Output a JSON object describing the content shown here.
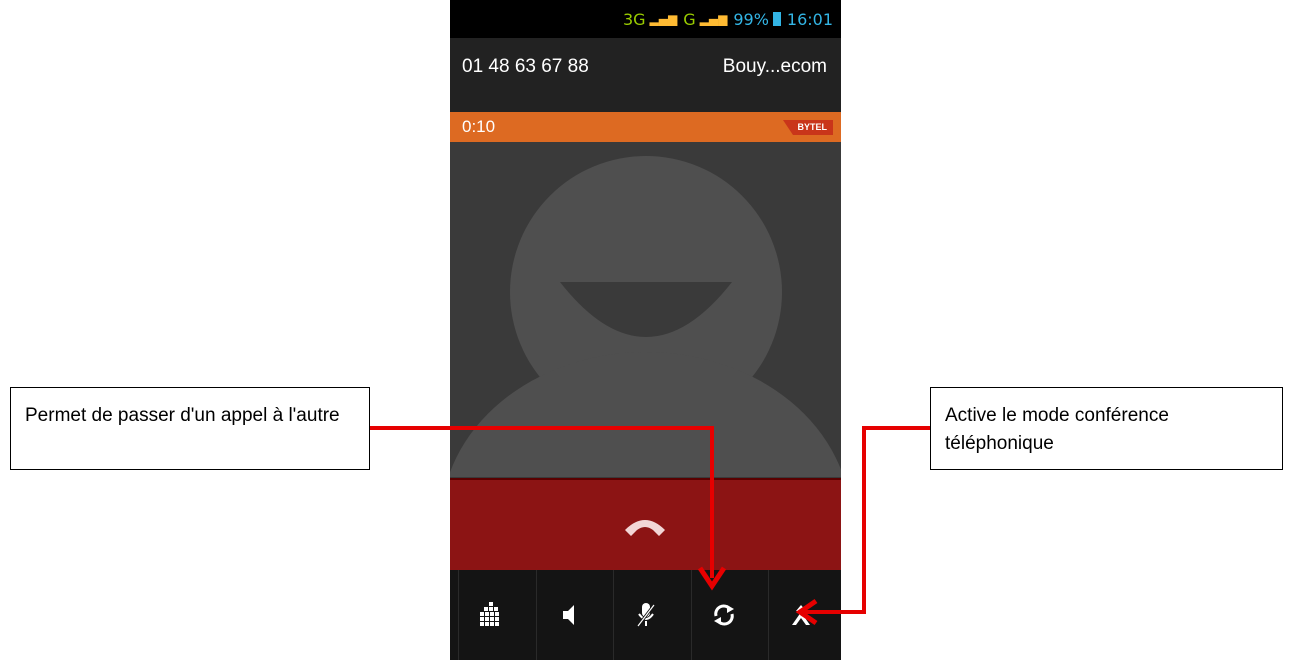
{
  "status_bar": {
    "network": "3G",
    "network2": "G",
    "battery": "99%",
    "time": "16:01"
  },
  "call": {
    "number": "01 48 63 67 88",
    "operator": "Bouy...ecom",
    "duration": "0:10",
    "badge": "BYTEL"
  },
  "controls": [
    {
      "name": "dialpad-icon"
    },
    {
      "name": "speaker-icon"
    },
    {
      "name": "mute-icon"
    },
    {
      "name": "swap-call-icon"
    },
    {
      "name": "merge-call-icon"
    }
  ],
  "callouts": {
    "left": "Permet de passer d'un appel à l'autre",
    "right": "Active le mode conférence téléphonique"
  },
  "colors": {
    "accent_orange": "#dd6a22",
    "hangup_red": "#8c1414",
    "arrow_red": "#e60000"
  }
}
